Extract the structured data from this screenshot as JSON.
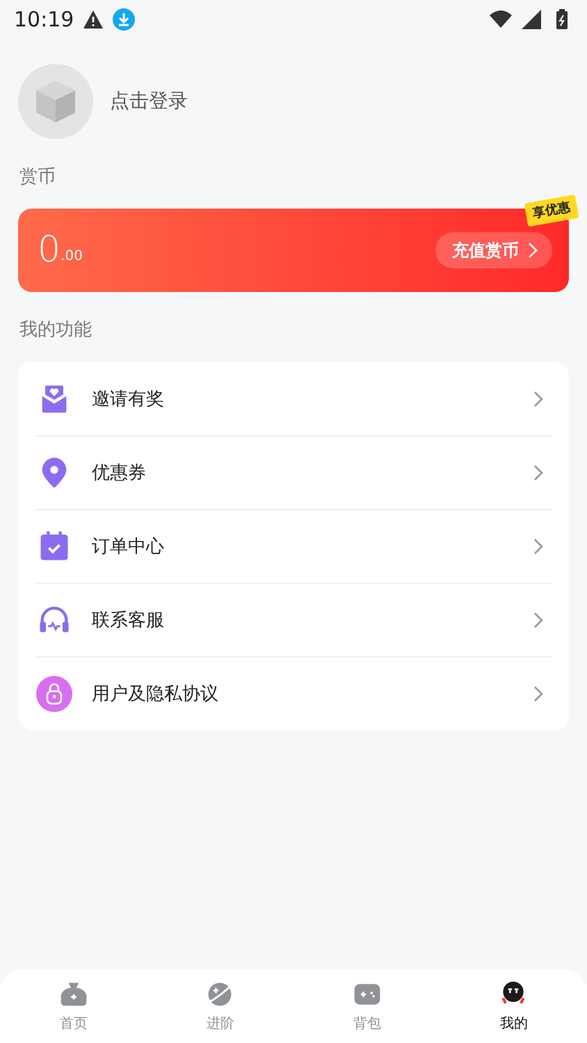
{
  "status_bar": {
    "time": "10:19"
  },
  "profile": {
    "login_label": "点击登录"
  },
  "coins": {
    "section_title": "赏币",
    "amount": "0",
    "decimals": ".00",
    "recharge_button": "充值赏币",
    "badge": "享优惠"
  },
  "functions": {
    "section_title": "我的功能",
    "items": [
      {
        "label": "邀请有奖"
      },
      {
        "label": "优惠券"
      },
      {
        "label": "订单中心"
      },
      {
        "label": "联系客服"
      },
      {
        "label": "用户及隐私协议"
      }
    ]
  },
  "tab_bar": [
    {
      "label": "首页",
      "selected": false
    },
    {
      "label": "进阶",
      "selected": false
    },
    {
      "label": "背包",
      "selected": false
    },
    {
      "label": "我的",
      "selected": true
    }
  ]
}
